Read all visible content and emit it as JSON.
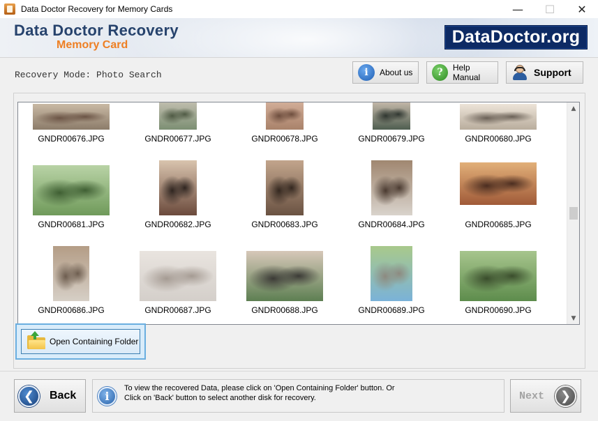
{
  "window": {
    "title": "Data Doctor Recovery for Memory Cards",
    "controls": {
      "minimize": "—",
      "maximize": "☐",
      "close": "✕"
    }
  },
  "header": {
    "brand_title": "Data Doctor Recovery",
    "brand_subtitle": "Memory Card",
    "logo_text": "DataDoctor.org"
  },
  "toolbar": {
    "mode_label": "Recovery Mode: Photo Search",
    "about_label": "About us",
    "help_label": "Help Manual",
    "support_label": "Support"
  },
  "thumbnails": [
    {
      "caption": "GNDR00676.JPG",
      "palette": [
        "#8c7c6a",
        "#c9b9a4",
        "#6b5445"
      ]
    },
    {
      "caption": "GNDR00677.JPG",
      "palette": [
        "#7c8f73",
        "#c7c2b4",
        "#4f5a44"
      ]
    },
    {
      "caption": "GNDR00678.JPG",
      "palette": [
        "#a9826a",
        "#d6b29d",
        "#6d4d3d"
      ]
    },
    {
      "caption": "GNDR00679.JPG",
      "palette": [
        "#4f5e50",
        "#d0c1b2",
        "#2f3630"
      ]
    },
    {
      "caption": "GNDR00680.JPG",
      "palette": [
        "#b9ad9d",
        "#ede4d8",
        "#6b6157"
      ]
    },
    {
      "caption": "GNDR00681.JPG",
      "palette": [
        "#6f9a5a",
        "#b9d3a6",
        "#3f5f33"
      ]
    },
    {
      "caption": "GNDR00682.JPG",
      "palette": [
        "#6b4a3c",
        "#d9c4ae",
        "#2f2520"
      ]
    },
    {
      "caption": "GNDR00683.JPG",
      "palette": [
        "#6a5242",
        "#c2a58c",
        "#33271f"
      ]
    },
    {
      "caption": "GNDR00684.JPG",
      "palette": [
        "#d9d3cc",
        "#a08770",
        "#4a3a30"
      ]
    },
    {
      "caption": "GNDR00685.JPG",
      "palette": [
        "#a05a38",
        "#e2b079",
        "#4b2d20"
      ]
    },
    {
      "caption": "GNDR00686.JPG",
      "palette": [
        "#d6cfc6",
        "#b49d86",
        "#6d5d4f"
      ]
    },
    {
      "caption": "GNDR00687.JPG",
      "palette": [
        "#d4cfca",
        "#e9e4df",
        "#a59b93"
      ]
    },
    {
      "caption": "GNDR00688.JPG",
      "palette": [
        "#5d7f52",
        "#d7c8b9",
        "#3b3a36"
      ]
    },
    {
      "caption": "GNDR00689.JPG",
      "palette": [
        "#7ab2d8",
        "#a9c98b",
        "#8d8a80"
      ]
    },
    {
      "caption": "GNDR00690.JPG",
      "palette": [
        "#5d8c4c",
        "#a7c58d",
        "#3a4d2c"
      ]
    }
  ],
  "actions": {
    "open_folder_label": "Open Containing Folder",
    "back_label": "Back",
    "next_label": "Next",
    "info_line1": "To view the recovered Data, please click on 'Open Containing Folder' button. Or",
    "info_line2": "Click on 'Back' button to select another disk for recovery."
  },
  "colors": {
    "brand_blue": "#27436d",
    "brand_orange": "#ee7f23",
    "logo_bg": "#0d2a64",
    "focus_blue": "#6aaee0"
  }
}
